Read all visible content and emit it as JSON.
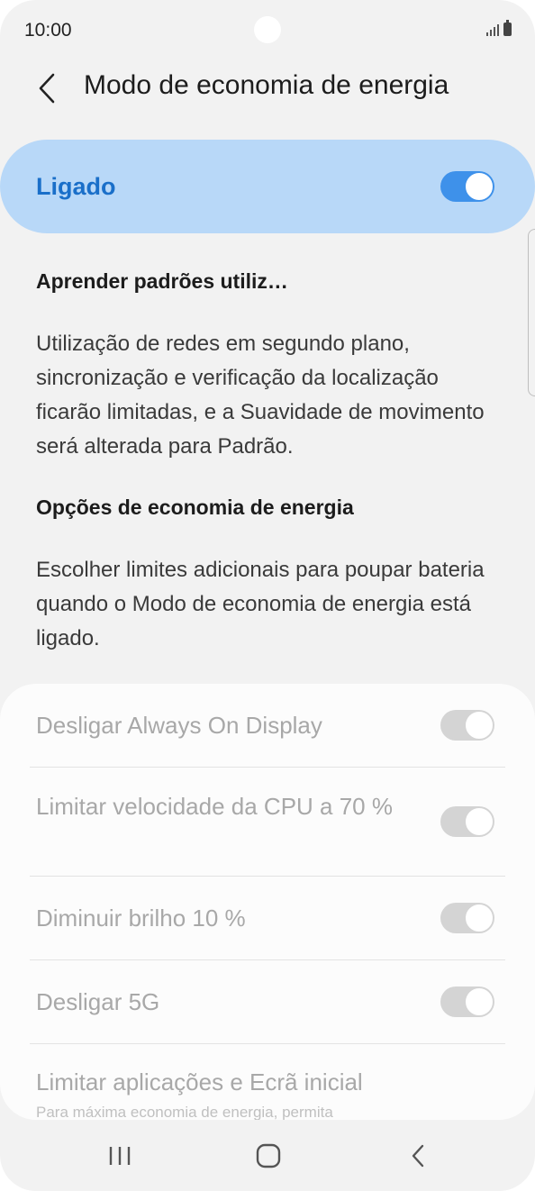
{
  "status_bar": {
    "time": "10:00",
    "icons": [
      "signal-icon",
      "battery-icon"
    ]
  },
  "header": {
    "back_icon": "chevron-left-icon",
    "title": "Modo de economia de energia"
  },
  "master_switch": {
    "label": "Ligado",
    "state": "on",
    "accent_color": "#1a6fc9",
    "background_color": "#b8d8f8"
  },
  "learn_section": {
    "heading": "Aprender padrões utiliz…",
    "body": "Utilização de redes em segundo plano, sincronização e verificação da localização ficarão limitadas, e a Suavidade de movimento será alterada para Padrão."
  },
  "options_section": {
    "heading": "Opções de economia de energia",
    "body": "Escolher limites adicionais para poupar bateria quando o Modo de economia de energia está ligado."
  },
  "options": [
    {
      "label": "Desligar Always On Display",
      "state": "on",
      "enabled": false
    },
    {
      "label": "Limitar velocidade da CPU a 70 %",
      "state": "on",
      "enabled": false
    },
    {
      "label": "Diminuir brilho 10 %",
      "state": "on",
      "enabled": false
    },
    {
      "label": "Desligar 5G",
      "state": "on",
      "enabled": false
    },
    {
      "label": "Limitar aplicações e Ecrã inicial",
      "subtext": "Para máxima economia de energia, permita",
      "enabled": false
    }
  ],
  "nav_bar": {
    "recents_icon": "recents-icon",
    "home_icon": "home-icon",
    "back_icon": "back-icon"
  }
}
